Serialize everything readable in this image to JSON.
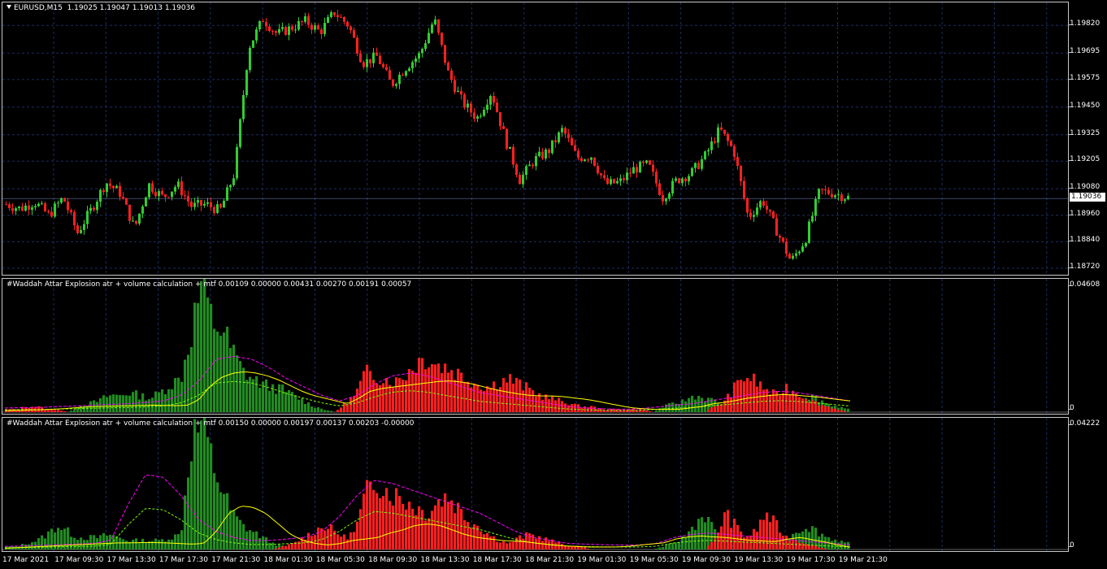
{
  "main": {
    "symbol_label": "EURUSD,M15",
    "ohlc": "1.19025 1.19047 1.19013 1.19036",
    "current_price": "1.19036",
    "price_min": 1.1872,
    "price_max": 1.1988,
    "price_ticks": [
      "1.19820",
      "1.19695",
      "1.19575",
      "1.19450",
      "1.19325",
      "1.19205",
      "1.19080",
      "1.18960",
      "1.18840",
      "1.18720"
    ],
    "price_path": [
      1.1901,
      1.1899,
      1.1902,
      1.1896,
      1.1904,
      1.1888,
      1.1899,
      1.1911,
      1.1906,
      1.189,
      1.191,
      1.1904,
      1.191,
      1.19,
      1.1901,
      1.1898,
      1.1915,
      1.1972,
      1.1985,
      1.1978,
      1.1981,
      1.1984,
      1.1979,
      1.1988,
      1.1982,
      1.1965,
      1.1968,
      1.1955,
      1.1963,
      1.1969,
      1.1985,
      1.196,
      1.1947,
      1.194,
      1.1952,
      1.193,
      1.1912,
      1.1921,
      1.1925,
      1.1935,
      1.1922,
      1.1923,
      1.191,
      1.1911,
      1.1917,
      1.1919,
      1.1904,
      1.1912,
      1.1915,
      1.1923,
      1.1935,
      1.1925,
      1.1895,
      1.1903,
      1.1889,
      1.1875,
      1.1885,
      1.1907,
      1.1906,
      1.1904
    ]
  },
  "indicator1": {
    "title": "#Waddah Attar Explosion atr + volume calculation + mtf 0.00109 0.00000 0.00431 0.00270 0.00191 0.00057",
    "top_value": "0.04608",
    "zero_label": "0",
    "max": 0.04608,
    "green": [
      0,
      0,
      0,
      0,
      0,
      0,
      0,
      0.002,
      0.003,
      0.004,
      0.006,
      0.006,
      0.007,
      0.006,
      0.005,
      0.007,
      0.01,
      0.012,
      0.028,
      0.046,
      0.033,
      0.03,
      0.022,
      0.015,
      0.012,
      0.01,
      0.009,
      0.008,
      0.006,
      0.004,
      0.002,
      0.001,
      0,
      0,
      0,
      0,
      0,
      0,
      0,
      0,
      0,
      0,
      0,
      0,
      0,
      0,
      0,
      0,
      0,
      0,
      0,
      0,
      0,
      0,
      0,
      0,
      0,
      0,
      0,
      0,
      0,
      0,
      0,
      0,
      0.002,
      0.003,
      0.004,
      0.006,
      0.005,
      0.004,
      0.003,
      0.002,
      0,
      0,
      0,
      0,
      0.002,
      0.004,
      0.006,
      0.005,
      0.003,
      0.002,
      0.001
    ],
    "red": [
      0.001,
      0.001,
      0.002,
      0.002,
      0.001,
      0.001,
      0,
      0,
      0,
      0,
      0,
      0,
      0,
      0,
      0,
      0,
      0,
      0,
      0,
      0,
      0,
      0,
      0,
      0,
      0,
      0,
      0,
      0,
      0,
      0,
      0,
      0,
      0,
      0.003,
      0.006,
      0.014,
      0.013,
      0.012,
      0.011,
      0.014,
      0.018,
      0.02,
      0.017,
      0.016,
      0.014,
      0.012,
      0.01,
      0.009,
      0.011,
      0.012,
      0.01,
      0.008,
      0.006,
      0.005,
      0.004,
      0.003,
      0.002,
      0.002,
      0.001,
      0.001,
      0.001,
      0.001,
      0.001,
      0,
      0,
      0,
      0,
      0,
      0,
      0.002,
      0.004,
      0.009,
      0.013,
      0.011,
      0.008,
      0.006,
      0.009,
      0.007,
      0.005,
      0.003,
      0.002,
      0.001,
      0
    ],
    "signal": [
      0.0005,
      0.0006,
      0.0007,
      0.0008,
      0.001,
      0.0012,
      0.0015,
      0.0018,
      0.002,
      0.0021,
      0.0022,
      0.0023,
      0.0024,
      0.0025,
      0.0024,
      0.0023,
      0.0025,
      0.0045,
      0.0095,
      0.0125,
      0.014,
      0.0145,
      0.014,
      0.013,
      0.0115,
      0.0095,
      0.0075,
      0.006,
      0.005,
      0.004,
      0.003,
      0.005,
      0.0075,
      0.0085,
      0.009,
      0.0095,
      0.01,
      0.0105,
      0.011,
      0.0112,
      0.0108,
      0.01,
      0.009,
      0.008,
      0.0072,
      0.0065,
      0.006,
      0.0058,
      0.0058,
      0.0055,
      0.005,
      0.0045,
      0.0038,
      0.003,
      0.0022,
      0.0015,
      0.0012,
      0.001,
      0.001,
      0.001,
      0.0015,
      0.002,
      0.003,
      0.0035,
      0.0042,
      0.005,
      0.0055,
      0.006,
      0.0063,
      0.0062,
      0.0058,
      0.0055,
      0.005,
      0.0045,
      0.004
    ],
    "dead": [
      0.0015,
      0.0016,
      0.0017,
      0.002,
      0.0022,
      0.0025,
      0.0028,
      0.003,
      0.0035,
      0.004,
      0.006,
      0.011,
      0.019,
      0.02,
      0.019,
      0.016,
      0.012,
      0.009,
      0.006,
      0.004,
      0.006,
      0.01,
      0.013,
      0.014,
      0.013,
      0.011,
      0.009,
      0.007,
      0.006,
      0.005,
      0.004,
      0.003,
      0.002,
      0.0015,
      0.0012,
      0.001,
      0.0012,
      0.0018,
      0.0025,
      0.003,
      0.004,
      0.005,
      0.006,
      0.007,
      0.0075,
      0.007,
      0.006,
      0.005,
      0.004
    ]
  },
  "indicator2": {
    "title": "#Waddah Attar Explosion atr + volume calculation + mtf 0.00150 0.00000 0.00197 0.00137 0.00203 -0.00000",
    "top_value": "0.04222",
    "zero_label": "0",
    "max": 0.04222,
    "green": [
      0.001,
      0.001,
      0.002,
      0.003,
      0.005,
      0.008,
      0.006,
      0.004,
      0.004,
      0.004,
      0.005,
      0.004,
      0.003,
      0.003,
      0.003,
      0.003,
      0.004,
      0.005,
      0.036,
      0.042,
      0.03,
      0.02,
      0.012,
      0.008,
      0.006,
      0.004,
      0.002,
      0.001,
      0,
      0,
      0,
      0,
      0,
      0,
      0,
      0,
      0,
      0,
      0,
      0,
      0,
      0,
      0,
      0,
      0,
      0,
      0,
      0,
      0,
      0,
      0,
      0,
      0,
      0,
      0,
      0,
      0,
      0,
      0,
      0,
      0,
      0,
      0,
      0,
      0.001,
      0.002,
      0.004,
      0.008,
      0.012,
      0.006,
      0.004,
      0.003,
      0.002,
      0.001,
      0.002,
      0.003,
      0.004,
      0.006,
      0.008,
      0.006,
      0.004,
      0.003,
      0.002
    ],
    "red": [
      0,
      0,
      0,
      0,
      0,
      0,
      0,
      0,
      0,
      0,
      0,
      0,
      0,
      0,
      0,
      0,
      0,
      0,
      0,
      0,
      0,
      0,
      0,
      0,
      0,
      0,
      0,
      0.001,
      0.002,
      0.004,
      0.006,
      0.008,
      0.006,
      0.004,
      0.006,
      0.018,
      0.024,
      0.02,
      0.018,
      0.016,
      0.014,
      0.012,
      0.016,
      0.018,
      0.014,
      0.01,
      0.008,
      0.005,
      0.003,
      0.002,
      0.004,
      0.005,
      0.004,
      0.003,
      0.002,
      0.001,
      0.001,
      0,
      0,
      0,
      0,
      0,
      0,
      0,
      0,
      0,
      0,
      0,
      0,
      0.003,
      0.012,
      0.008,
      0.004,
      0.006,
      0.012,
      0.008,
      0.004,
      0.003,
      0.002,
      0.001,
      0,
      0,
      0
    ],
    "signal": [
      0.0004,
      0.0006,
      0.0008,
      0.001,
      0.0012,
      0.0014,
      0.0016,
      0.0018,
      0.002,
      0.0022,
      0.0022,
      0.0023,
      0.0023,
      0.0022,
      0.002,
      0.0018,
      0.002,
      0.006,
      0.012,
      0.0145,
      0.014,
      0.012,
      0.0085,
      0.005,
      0.003,
      0.002,
      0.0015,
      0.002,
      0.003,
      0.0035,
      0.004,
      0.0055,
      0.0065,
      0.008,
      0.0085,
      0.008,
      0.0065,
      0.005,
      0.004,
      0.0035,
      0.003,
      0.0028,
      0.0025,
      0.002,
      0.0015,
      0.0012,
      0.001,
      0.0008,
      0.0008,
      0.0008,
      0.001,
      0.0014,
      0.0018,
      0.0022,
      0.0035,
      0.0042,
      0.0045,
      0.0042,
      0.004,
      0.0035,
      0.003,
      0.0028,
      0.0026,
      0.0035,
      0.004,
      0.0032,
      0.0025,
      0.0015,
      0.0008
    ],
    "dead": [
      0.001,
      0.0012,
      0.0014,
      0.0016,
      0.0018,
      0.002,
      0.003,
      0.015,
      0.025,
      0.024,
      0.018,
      0.01,
      0.006,
      0.004,
      0.003,
      0.003,
      0.0035,
      0.004,
      0.006,
      0.011,
      0.018,
      0.023,
      0.022,
      0.02,
      0.018,
      0.016,
      0.014,
      0.012,
      0.009,
      0.006,
      0.004,
      0.003,
      0.002,
      0.0018,
      0.0016,
      0.0015,
      0.0015,
      0.002,
      0.004,
      0.005,
      0.0055,
      0.005,
      0.0045,
      0.004,
      0.0035,
      0.003,
      0.0025,
      0.002,
      0.0015
    ]
  },
  "time_axis": {
    "labels": [
      "17 Mar 2021",
      "17 Mar 09:30",
      "17 Mar 13:30",
      "17 Mar 17:30",
      "17 Mar 21:30",
      "18 Mar 01:30",
      "18 Mar 05:30",
      "18 Mar 09:30",
      "18 Mar 13:30",
      "18 Mar 17:30",
      "18 Mar 21:30",
      "19 Mar 01:30",
      "19 Mar 05:30",
      "19 Mar 09:30",
      "19 Mar 13:30",
      "19 Mar 17:30",
      "19 Mar 21:30"
    ]
  },
  "colors": {
    "background": "#000000",
    "grid": "#1c2e62",
    "bull_candle": "#32cd32",
    "bear_candle": "#ff2020",
    "hist_green": "#228b22",
    "hist_red": "#ff2020",
    "signal_line": "#ffff00",
    "dead_zone_line": "#ff00ff",
    "dead_zone_line_2": "#7cfc00"
  }
}
